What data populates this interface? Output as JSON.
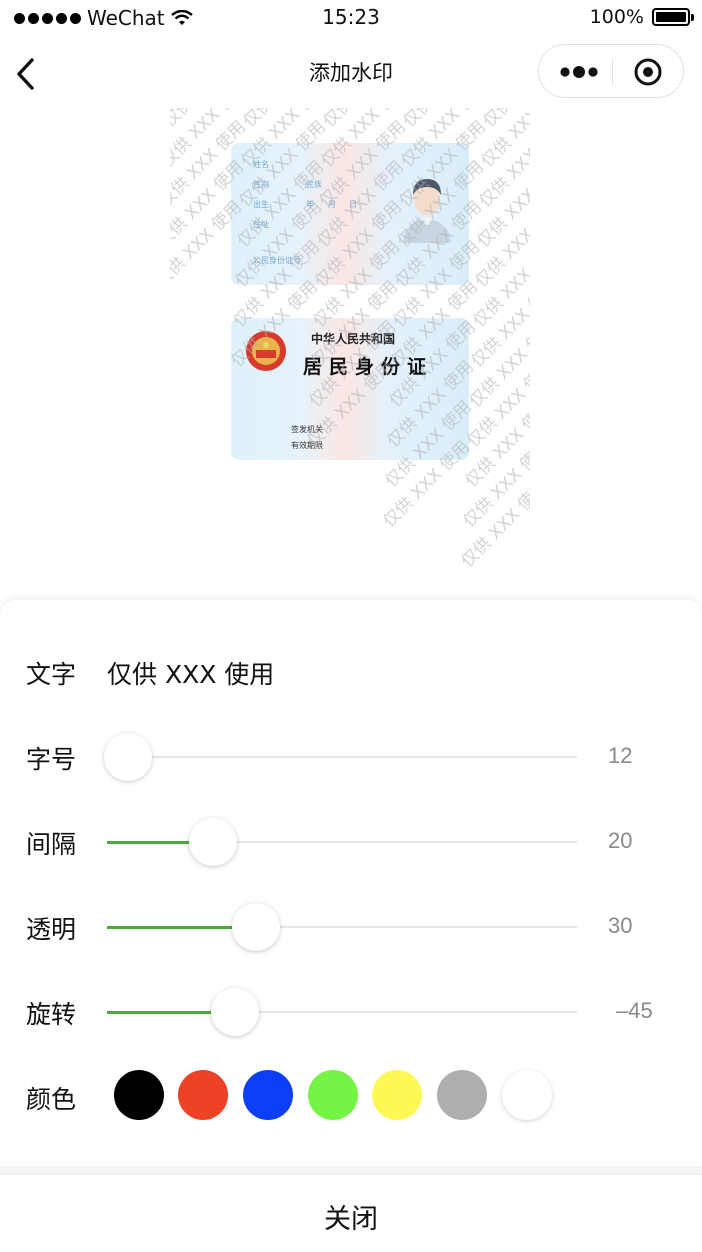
{
  "status_bar": {
    "carrier": "WeChat",
    "time": "15:23",
    "battery": "100%"
  },
  "nav": {
    "title": "添加水印"
  },
  "preview": {
    "watermark_text": "仅供 XXX 使用",
    "card_front": {
      "labels": [
        "姓名",
        "性别",
        "民族",
        "出生",
        "年",
        "月",
        "日",
        "住址",
        "公民身份证号"
      ]
    },
    "card_back": {
      "line1": "中华人民共和国",
      "line2": "居民身份证",
      "authority_label": "签发机关",
      "validity_label": "有效期限"
    }
  },
  "panel": {
    "text_label": "文字",
    "text_value": "仅供 XXX 使用",
    "sliders": [
      {
        "label": "字号",
        "value": "12",
        "fraction": 0.0
      },
      {
        "label": "间隔",
        "value": "20",
        "fraction": 0.198
      },
      {
        "label": "透明",
        "value": "30",
        "fraction": 0.298
      },
      {
        "label": "旋转",
        "value": "–45",
        "fraction": 0.25
      }
    ],
    "color_label": "颜色",
    "colors": [
      "#000000",
      "#ee4226",
      "#0c3ff5",
      "#74f546",
      "#fcf954",
      "#aeaeae",
      "#ffffff"
    ],
    "selected_color": null
  },
  "close_button": "关闭",
  "theme": {
    "accent": "#4aac35",
    "watermark_color": "#aeaeae"
  }
}
